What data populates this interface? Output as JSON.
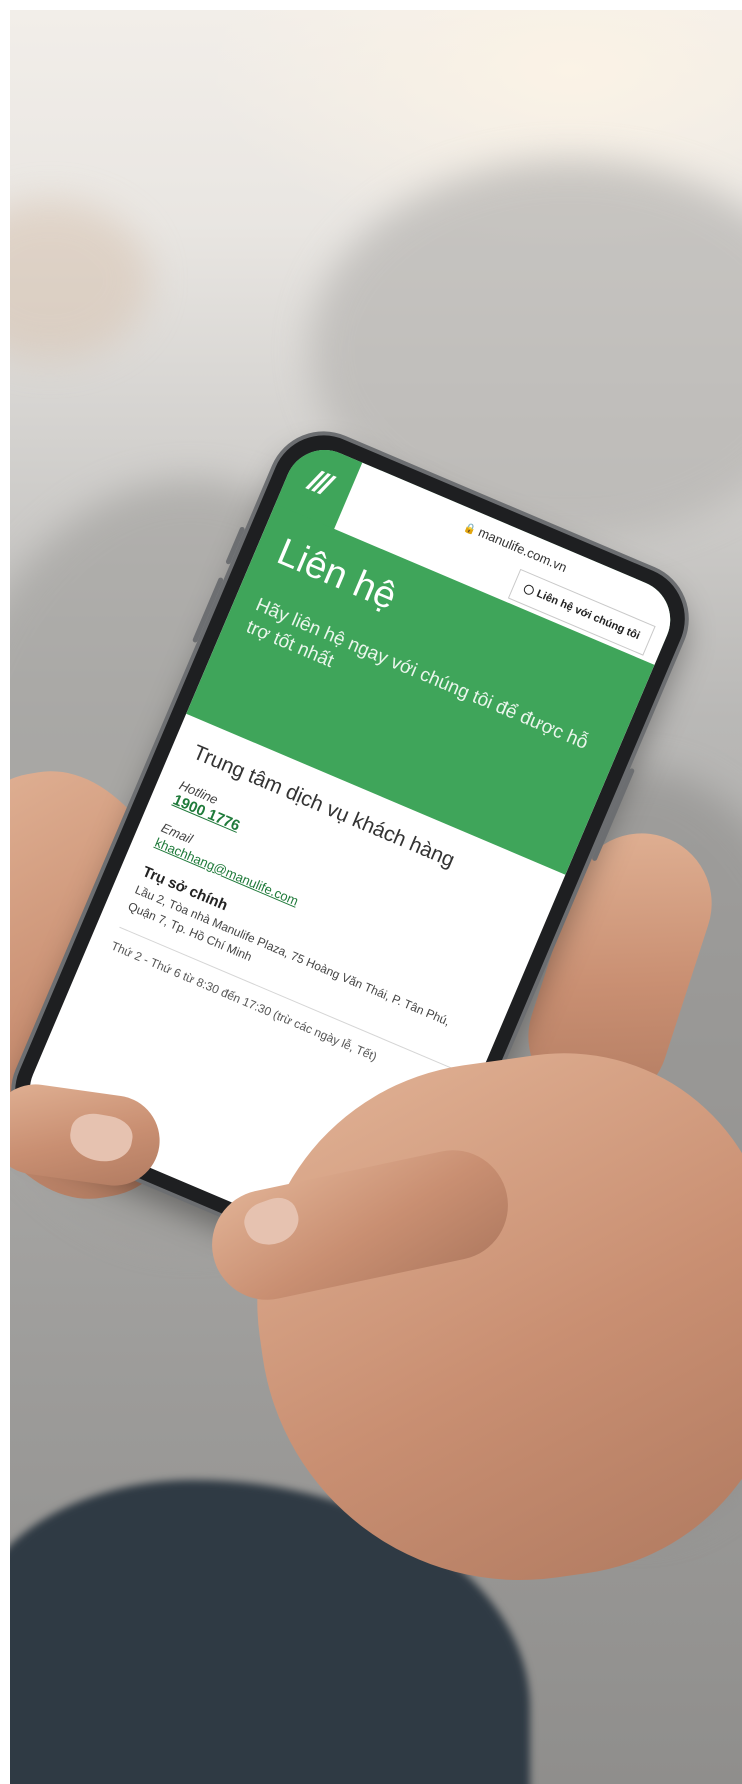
{
  "browser": {
    "url": "manulife.com.vn",
    "lock_icon": "lock-icon"
  },
  "header": {
    "logo": "manulife-logo",
    "contact_button_label": "Liên hệ với chúng tôi",
    "contact_button_icon": "clock-icon"
  },
  "hero": {
    "title": "Liên hệ",
    "subtitle": "Hãy liên hệ ngay với chúng tôi để được hỗ trợ tốt nhất"
  },
  "customer_service": {
    "heading": "Trung tâm dịch vụ khách hàng",
    "hotline_label": "Hotline",
    "hotline_value": "1900 1776",
    "email_label": "Email",
    "email_value": "khachhang@manulife.com",
    "hq_heading": "Trụ sở chính",
    "hq_address": "Lầu 2, Tòa nhà Manulife Plaza, 75 Hoàng Văn Thái, P. Tân Phú, Quận 7, Tp. Hồ Chí Minh",
    "hours": "Thứ 2 - Thứ 6 từ 8:30 đến 17:30 (trừ các ngày lễ, Tết)"
  },
  "colors": {
    "brand_green": "#3fa55a",
    "link_green": "#1f7a3a"
  }
}
